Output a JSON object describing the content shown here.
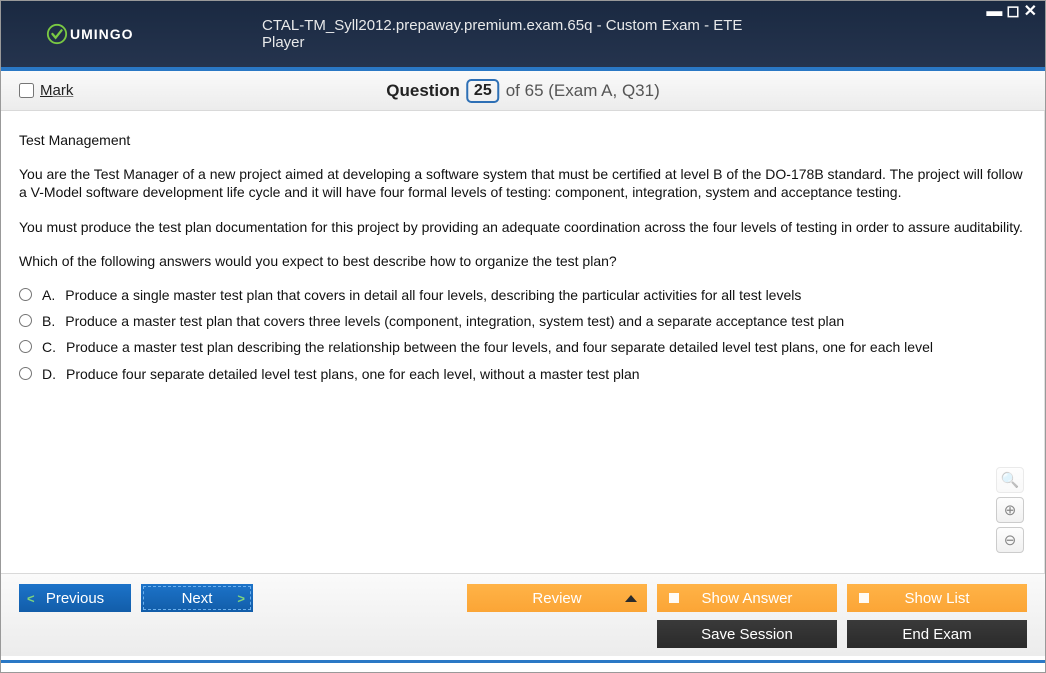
{
  "window": {
    "logo_text": "UMINGO",
    "title": "CTAL-TM_Syll2012.prepaway.premium.exam.65q - Custom Exam - ETE Player"
  },
  "header": {
    "mark_label": "Mark",
    "question_label": "Question",
    "question_number": "25",
    "question_rest": "of 65 (Exam A, Q31)"
  },
  "question": {
    "topic": "Test Management",
    "para1": "You are the Test Manager of a new project aimed at developing a software system that must be certified at level B of the DO-178B standard. The project will follow a V-Model software development life cycle and it will have four formal levels of testing: component, integration, system and acceptance testing.",
    "para2": "You must produce the test plan documentation for this project by providing an adequate coordination across the four levels of testing in order to assure auditability.",
    "prompt": "Which of the following answers would you expect to best describe how to organize the test plan?",
    "answers": [
      {
        "letter": "A.",
        "text": "Produce a single master test plan that covers in detail all four levels, describing the particular activities for all test levels"
      },
      {
        "letter": "B.",
        "text": "Produce a master test plan that covers three levels (component, integration, system test) and a separate acceptance test plan"
      },
      {
        "letter": "C.",
        "text": "Produce a master test plan describing the relationship between the four levels, and four separate detailed level test plans, one for each level"
      },
      {
        "letter": "D.",
        "text": "Produce four separate detailed level test plans, one for each level, without a master test plan"
      }
    ]
  },
  "footer": {
    "previous": "Previous",
    "next": "Next",
    "review": "Review",
    "show_answer": "Show Answer",
    "show_list": "Show List",
    "save_session": "Save Session",
    "end_exam": "End Exam"
  }
}
